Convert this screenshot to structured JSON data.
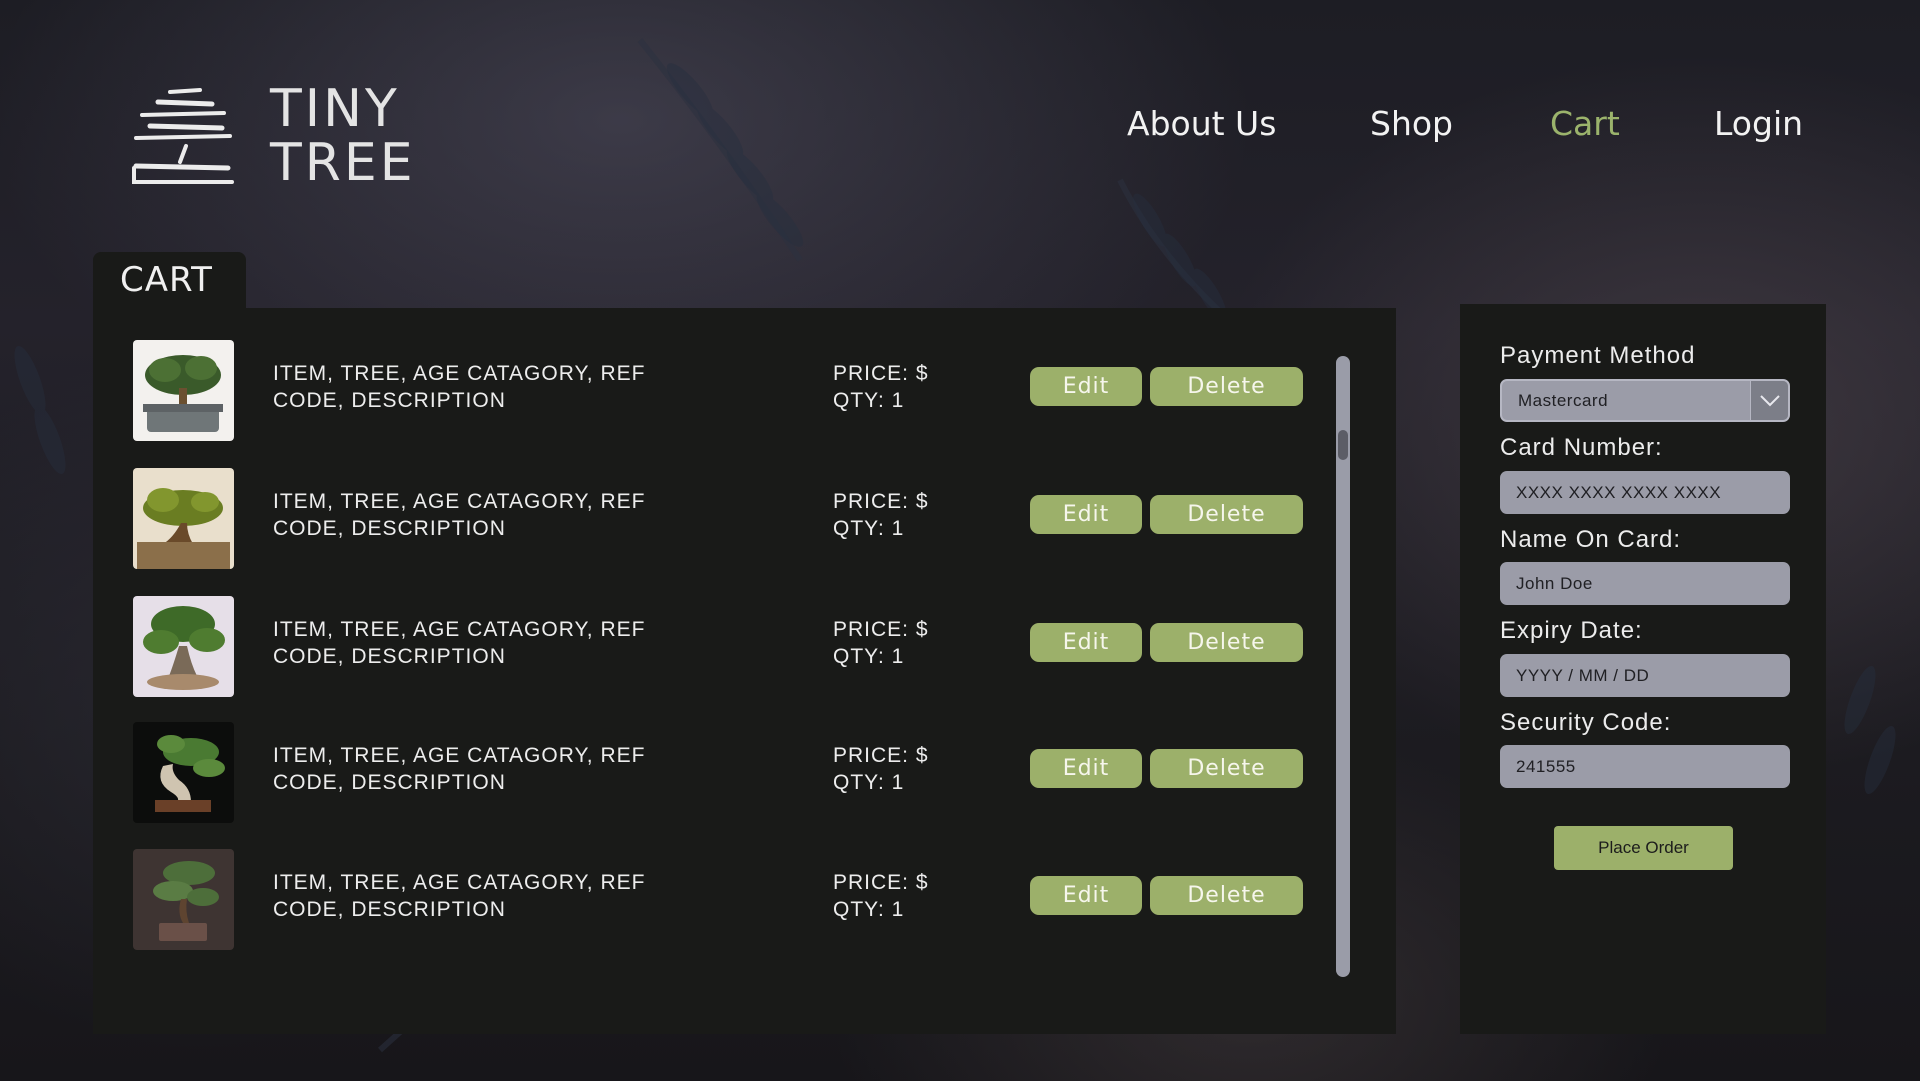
{
  "brand": {
    "line1": "TINY",
    "line2": "TREE"
  },
  "nav": [
    {
      "label": "About Us",
      "active": false
    },
    {
      "label": "Shop",
      "active": false
    },
    {
      "label": "Cart",
      "active": true
    },
    {
      "label": "Login",
      "active": false
    }
  ],
  "colors": {
    "accent": "#9cb06a",
    "panel": "#191a18",
    "input": "#9b9ca8"
  },
  "cart": {
    "title": "CART",
    "items": [
      {
        "desc": "ITEM, TREE, AGE CATAGORY, REF CODE, DESCRIPTION",
        "price": "PRICE: $",
        "qty": "QTY: 1",
        "edit": "Edit",
        "delete": "Delete"
      },
      {
        "desc": "ITEM, TREE, AGE CATAGORY, REF CODE, DESCRIPTION",
        "price": "PRICE: $",
        "qty": "QTY: 1",
        "edit": "Edit",
        "delete": "Delete"
      },
      {
        "desc": "ITEM, TREE, AGE CATAGORY, REF CODE, DESCRIPTION",
        "price": "PRICE: $",
        "qty": "QTY: 1",
        "edit": "Edit",
        "delete": "Delete"
      },
      {
        "desc": "ITEM, TREE, AGE CATAGORY, REF CODE, DESCRIPTION",
        "price": "PRICE: $",
        "qty": "QTY: 1",
        "edit": "Edit",
        "delete": "Delete"
      },
      {
        "desc": "ITEM, TREE, AGE CATAGORY, REF CODE, DESCRIPTION",
        "price": "PRICE: $",
        "qty": "QTY: 1",
        "edit": "Edit",
        "delete": "Delete"
      }
    ]
  },
  "payment": {
    "method_label": "Payment Method",
    "method_value": "Mastercard",
    "card_label": "Card Number:",
    "card_value": "XXXX XXXX XXXX XXXX",
    "name_label": "Name On Card:",
    "name_value": "John Doe",
    "expiry_label": "Expiry Date:",
    "expiry_value": "YYYY / MM / DD",
    "security_label": "Security Code:",
    "security_value": "241555",
    "submit": "Place Order"
  }
}
